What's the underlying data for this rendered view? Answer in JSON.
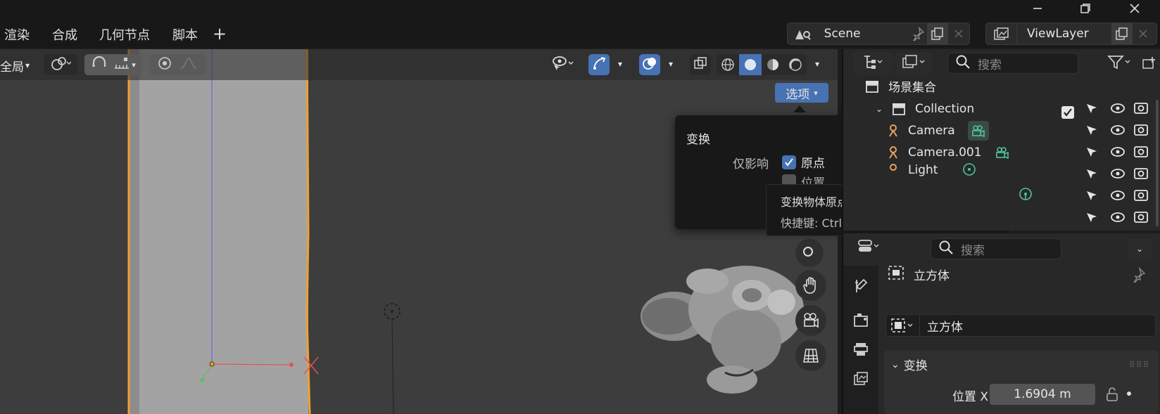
{
  "titlebar": {
    "minimize_icon": "minimize-icon",
    "restore_icon": "restore-icon",
    "close_icon": "close-icon"
  },
  "workspace_tabs": [
    "渲染",
    "合成",
    "几何节点",
    "脚本"
  ],
  "add_tab_label": "+",
  "scene": {
    "name": "Scene"
  },
  "view_layer": {
    "name": "ViewLayer"
  },
  "viewport": {
    "transform_orientation": "全局",
    "options_label": "选项"
  },
  "popover": {
    "section_title": "变换",
    "affect_only_label": "仅影响",
    "origins_label": "原点",
    "origins_checked": true,
    "locations_label": "位置",
    "locations_checked": false
  },
  "tooltip": {
    "description": "变换物体原点，同时保持形状位置不变.",
    "shortcut": "快捷键: Ctrl ."
  },
  "outliner": {
    "search_placeholder": "搜索",
    "root_label": "场景集合",
    "items": [
      {
        "label": "Collection",
        "type": "collection"
      },
      {
        "label": "Camera",
        "type": "camera"
      },
      {
        "label": "Camera.001",
        "type": "camera"
      },
      {
        "label": "Light",
        "type": "light"
      }
    ]
  },
  "properties": {
    "search_placeholder": "搜索",
    "object_title": "立方体",
    "object_name_value": "立方体",
    "transform_panel_label": "变换",
    "location_x_label": "位置 X",
    "location_x_value": "1.6904 m"
  },
  "colors": {
    "accent": "#4772b3",
    "selection_outline": "#f0a030",
    "bg_viewport": "#3d3d3d",
    "panel": "#282828"
  }
}
